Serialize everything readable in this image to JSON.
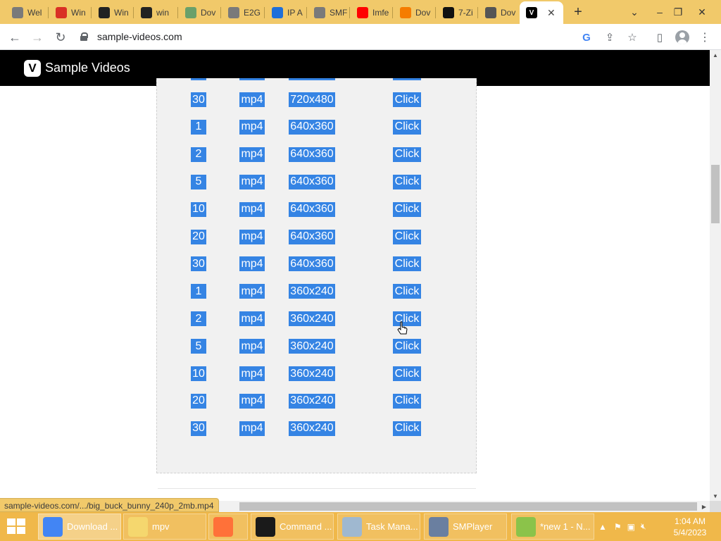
{
  "browser": {
    "tabs": [
      {
        "label": "Wel",
        "icon": "globe-icon",
        "color": "#7a7a7a"
      },
      {
        "label": "Win",
        "icon": "cards-icon",
        "color": "#d93025"
      },
      {
        "label": "Win",
        "icon": "bank-icon",
        "color": "#222222"
      },
      {
        "label": "win",
        "icon": "bank-icon",
        "color": "#222222"
      },
      {
        "label": "Dov",
        "icon": "checkmark-icon",
        "color": "#6aa06a"
      },
      {
        "label": "E2G",
        "icon": "globe-icon",
        "color": "#7a7a7a"
      },
      {
        "label": "IP A",
        "icon": "ip-icon",
        "color": "#1e6fd9"
      },
      {
        "label": "SMF",
        "icon": "globe-icon",
        "color": "#7a7a7a"
      },
      {
        "label": "Imfe",
        "icon": "youtube-icon",
        "color": "#ff0000"
      },
      {
        "label": "Dov",
        "icon": "diamond-icon",
        "color": "#f57c00"
      },
      {
        "label": "7-Zi",
        "icon": "7zip-icon",
        "color": "#111111"
      },
      {
        "label": "Dov",
        "icon": "download-icon",
        "color": "#555555"
      }
    ],
    "active_tab_icon": "V",
    "url": "sample-videos.com",
    "status_url": "sample-videos.com/.../big_buck_bunny_240p_2mb.mp4"
  },
  "site": {
    "logo": "V",
    "brand": "Sample Videos"
  },
  "table": {
    "rows": [
      {
        "size": "30",
        "format": "mp4",
        "resolution": "720x480",
        "link": "Click"
      },
      {
        "size": "1",
        "format": "mp4",
        "resolution": "640x360",
        "link": "Click"
      },
      {
        "size": "2",
        "format": "mp4",
        "resolution": "640x360",
        "link": "Click"
      },
      {
        "size": "5",
        "format": "mp4",
        "resolution": "640x360",
        "link": "Click"
      },
      {
        "size": "10",
        "format": "mp4",
        "resolution": "640x360",
        "link": "Click"
      },
      {
        "size": "20",
        "format": "mp4",
        "resolution": "640x360",
        "link": "Click"
      },
      {
        "size": "30",
        "format": "mp4",
        "resolution": "640x360",
        "link": "Click"
      },
      {
        "size": "1",
        "format": "mp4",
        "resolution": "360x240",
        "link": "Click"
      },
      {
        "size": "2",
        "format": "mp4",
        "resolution": "360x240",
        "link": "Click"
      },
      {
        "size": "5",
        "format": "mp4",
        "resolution": "360x240",
        "link": "Click"
      },
      {
        "size": "10",
        "format": "mp4",
        "resolution": "360x240",
        "link": "Click"
      },
      {
        "size": "20",
        "format": "mp4",
        "resolution": "360x240",
        "link": "Click"
      },
      {
        "size": "30",
        "format": "mp4",
        "resolution": "360x240",
        "link": "Click"
      }
    ]
  },
  "taskbar": {
    "items": [
      {
        "label": "Download ...",
        "icon": "chrome-icon",
        "color": "#4285f4"
      },
      {
        "label": "mpv",
        "icon": "folder-icon",
        "color": "#f5d76e"
      },
      {
        "label": "",
        "icon": "firefox-icon",
        "color": "#ff7139"
      },
      {
        "label": "Command ...",
        "icon": "terminal-icon",
        "color": "#1a1a1a"
      },
      {
        "label": "Task Mana...",
        "icon": "task-manager-icon",
        "color": "#9fb8d0"
      },
      {
        "label": "SMPlayer",
        "icon": "smplayer-icon",
        "color": "#6a7fa0"
      },
      {
        "label": "*new 1 - N...",
        "icon": "notepad-plus-icon",
        "color": "#8bc34a"
      }
    ],
    "time": "1:04 AM",
    "date": "5/4/2023"
  },
  "colors": {
    "selection": "#3584e4",
    "tabbar": "#f1c96a",
    "taskbar": "#f0b84a"
  }
}
